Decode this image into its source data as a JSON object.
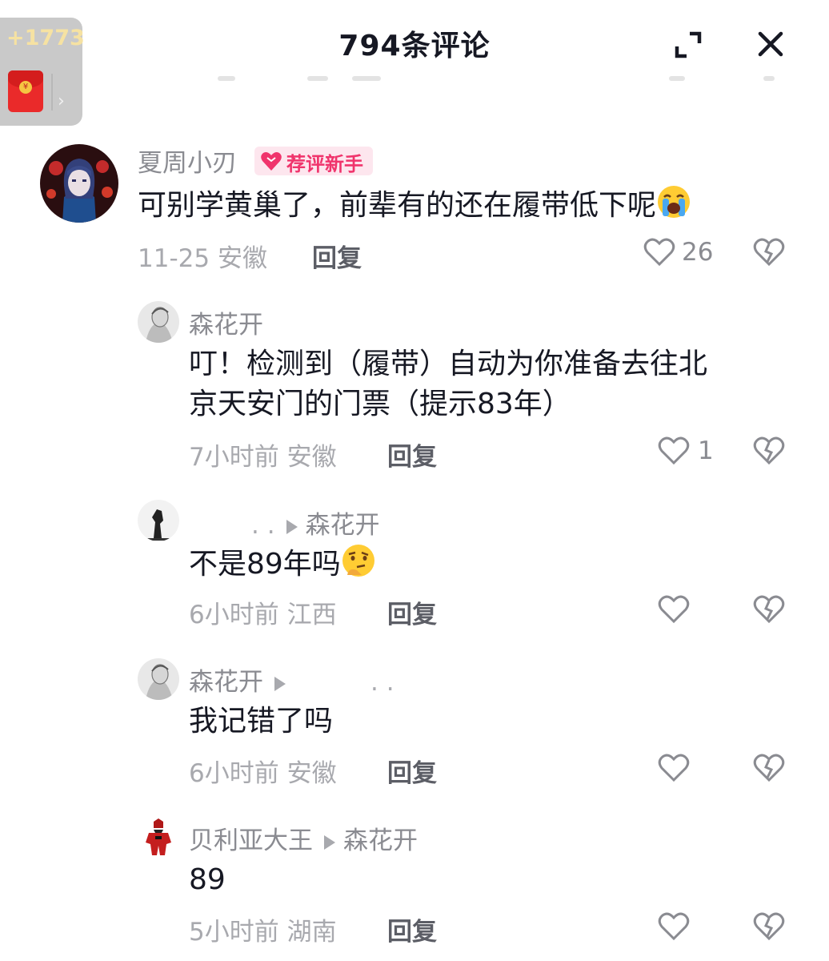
{
  "header": {
    "title": "794条评论",
    "red_packet": {
      "count": "+1773",
      "seal": "¥",
      "arrow": "›"
    }
  },
  "main_comment": {
    "username": "夏周小刃",
    "badge": "荐评新手",
    "text": "可别学黄巢了，前辈有的还在履带低下呢",
    "emoji": "loudly-crying-face",
    "date": "11-25",
    "location": "安徽",
    "reply_label": "回复",
    "likes": "26"
  },
  "replies": [
    {
      "username": "森花开",
      "text_line1": "叮！检测到（履带）自动为你准备去往北",
      "text_line2": "京天安门的门票（提示83年）",
      "time": "7小时前",
      "location": "安徽",
      "reply_label": "回复",
      "likes": "1"
    },
    {
      "username": ".   .",
      "reply_to": "森花开",
      "text": "不是89年吗",
      "emoji": "thinking-face",
      "time": "6小时前",
      "location": "江西",
      "reply_label": "回复"
    },
    {
      "username": "森花开",
      "reply_to": ".   .",
      "text": "我记错了吗",
      "time": "6小时前",
      "location": "安徽",
      "reply_label": "回复"
    },
    {
      "username": "贝利亚大王",
      "reply_to": "森花开",
      "text": "89",
      "time": "5小时前",
      "location": "湖南",
      "reply_label": "回复"
    }
  ],
  "colors": {
    "accent": "#f0346c",
    "badge_bg": "#fde6ee",
    "red_packet": "#ea2a2a"
  }
}
